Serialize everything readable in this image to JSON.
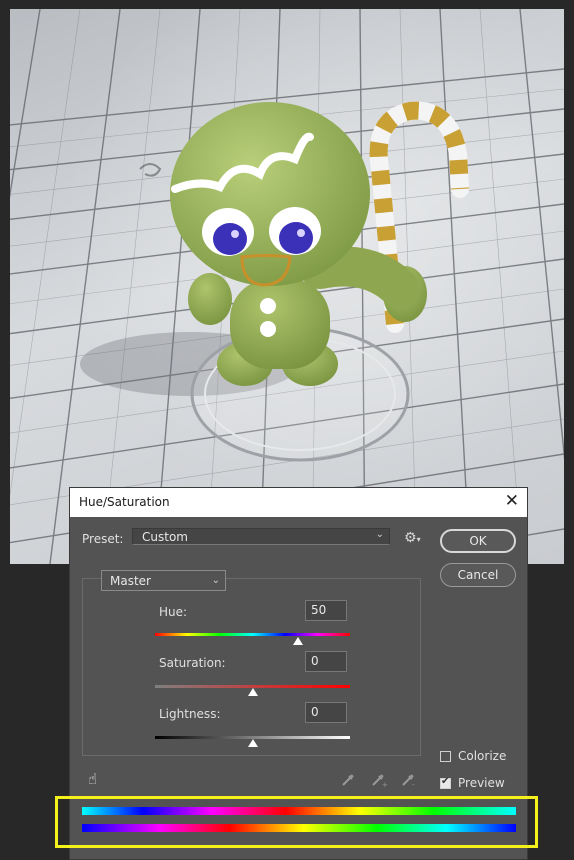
{
  "dialog": {
    "title": "Hue/Saturation",
    "close_glyph": "✕",
    "preset_label": "Preset:",
    "preset_value": "Custom",
    "gear_icon": "gear-icon",
    "ok_label": "OK",
    "cancel_label": "Cancel",
    "channel_value": "Master",
    "sliders": {
      "hue": {
        "label": "Hue:",
        "value": "50",
        "thumb_fraction": 0.733
      },
      "saturation": {
        "label": "Saturation:",
        "value": "0",
        "thumb_fraction": 0.5
      },
      "lightness": {
        "label": "Lightness:",
        "value": "0",
        "thumb_fraction": 0.5
      }
    },
    "colorize_label": "Colorize",
    "colorize_checked": false,
    "preview_label": "Preview",
    "preview_checked": true,
    "tools": [
      "hand-target-icon",
      "eyedropper-icon",
      "eyedropper-plus-icon",
      "eyedropper-minus-icon"
    ]
  },
  "colors": {
    "dialog_bg": "#535353",
    "highlight": "#f5ef1c",
    "figure_green": "#9bb35c"
  }
}
